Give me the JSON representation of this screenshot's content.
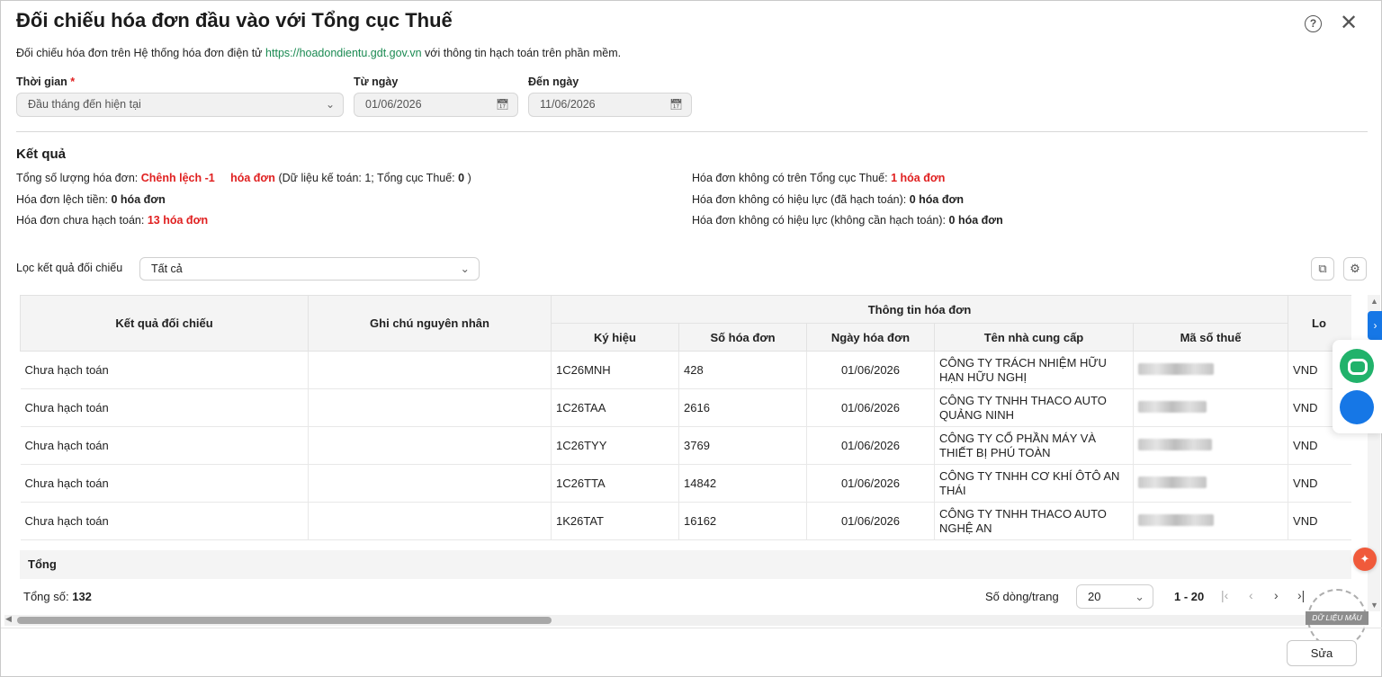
{
  "dialog": {
    "title": "Đối chiếu hóa đơn đầu vào với Tổng cục Thuế",
    "help_icon": "?",
    "close_icon": "✕",
    "desc_before": "Đối chiếu hóa đơn trên Hệ thống hóa đơn điện tử",
    "desc_link": "https://hoadondientu.gdt.gov.vn",
    "desc_after": "với thông tin hạch toán trên phần mềm."
  },
  "period": {
    "time_label": "Thời gian",
    "required_mark": "*",
    "time_value": "Đầu tháng đến hiện tại",
    "from_label": "Từ ngày",
    "from_value": "01/06/2026",
    "to_label": "Đến ngày",
    "to_value": "11/06/2026"
  },
  "result": {
    "heading": "Kết quả",
    "total_prefix": "Tổng số lượng hóa đơn:",
    "total_diff": "Chênh lệch -1",
    "total_unit": "hóa đơn",
    "total_detail_a": "(Dữ liệu kế toán: 1; Tổng cục Thuế:",
    "total_detail_num": "0",
    "total_detail_b": ")",
    "lech_tien_prefix": "Hóa đơn lệch tiền:",
    "lech_tien_value": "0 hóa đơn",
    "chua_hach_toan_prefix": "Hóa đơn chưa hạch toán:",
    "chua_hach_toan_num": "13",
    "chua_hach_toan_unit": "hóa đơn",
    "khong_co_prefix": "Hóa đơn không có trên Tổng cục Thuế:",
    "khong_co_value": "1 hóa đơn",
    "khong_hieu_luc_da_prefix": "Hóa đơn không có hiệu lực (đã hạch toán):",
    "khong_hieu_luc_da_value": "0 hóa đơn",
    "khong_hieu_luc_khong_prefix": "Hóa đơn không có hiệu lực (không cần hạch toán):",
    "khong_hieu_luc_khong_value": "0 hóa đơn"
  },
  "filter": {
    "label": "Lọc kết quả đối chiếu",
    "value": "Tất cả",
    "export_icon": "export-icon",
    "settings_icon": "gear-icon"
  },
  "table": {
    "col_ket_qua": "Kết quả đối chiếu",
    "col_ghi_chu": "Ghi chú nguyên nhân",
    "group_thong_tin": "Thông tin hóa đơn",
    "col_ky_hieu": "Ký hiệu",
    "col_so_hd": "Số hóa đơn",
    "col_ngay_hd": "Ngày hóa đơn",
    "col_ten_ncc": "Tên nhà cung cấp",
    "col_mst": "Mã số thuế",
    "col_loai_partial": "Lo",
    "rows": [
      {
        "ket_qua": "Chưa hạch toán",
        "ghi_chu": "",
        "ky_hieu": "1C26MNH",
        "so_hd": "428",
        "ngay_hd": "01/06/2026",
        "ten_ncc": "CÔNG TY TRÁCH NHIỆM HỮU HẠN HỮU NGHỊ",
        "tien_te": "VND"
      },
      {
        "ket_qua": "Chưa hạch toán",
        "ghi_chu": "",
        "ky_hieu": "1C26TAA",
        "so_hd": "2616",
        "ngay_hd": "01/06/2026",
        "ten_ncc": "CÔNG TY TNHH THACO AUTO QUẢNG NINH",
        "tien_te": "VND"
      },
      {
        "ket_qua": "Chưa hạch toán",
        "ghi_chu": "",
        "ky_hieu": "1C26TYY",
        "so_hd": "3769",
        "ngay_hd": "01/06/2026",
        "ten_ncc": "CÔNG TY CỔ PHẦN MÁY VÀ THIẾT BỊ PHÚ TOÀN",
        "tien_te": "VND"
      },
      {
        "ket_qua": "Chưa hạch toán",
        "ghi_chu": "",
        "ky_hieu": "1C26TTA",
        "so_hd": "14842",
        "ngay_hd": "01/06/2026",
        "ten_ncc": "CÔNG TY TNHH CƠ KHÍ ÔTÔ AN THÁI",
        "tien_te": "VND"
      },
      {
        "ket_qua": "Chưa hạch toán",
        "ghi_chu": "",
        "ky_hieu": "1K26TAT",
        "so_hd": "16162",
        "ngay_hd": "01/06/2026",
        "ten_ncc": "CÔNG TY TNHH THACO AUTO NGHỆ AN",
        "tien_te": "VND"
      }
    ],
    "total_row_label": "Tổng"
  },
  "footer": {
    "total_label": "Tổng số:",
    "total_value": "132",
    "page_size_label": "Số dòng/trang",
    "page_size_value": "20",
    "range": "1 - 20"
  },
  "stamp_text": "DỮ LIỆU MẪU",
  "actions": {
    "edit_label": "Sửa"
  }
}
